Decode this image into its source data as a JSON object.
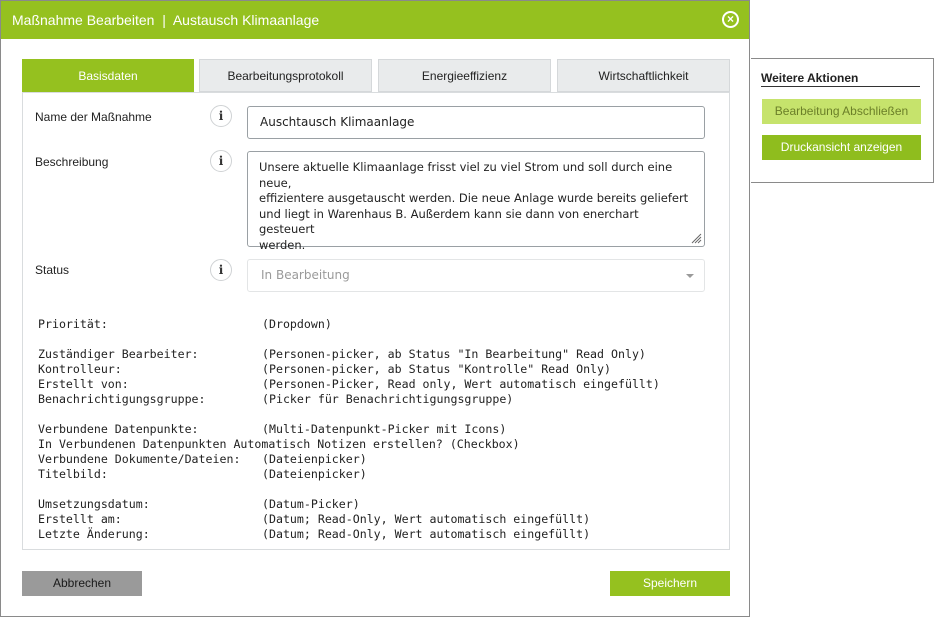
{
  "dialog": {
    "title": "Maßnahme Bearbeiten  |  Austausch Klimaanlage",
    "close_icon": "close-circle-icon"
  },
  "tabs": [
    {
      "label": "Basisdaten",
      "active": true
    },
    {
      "label": "Bearbeitungsprotokoll",
      "active": false
    },
    {
      "label": "Energieeffizienz",
      "active": false
    },
    {
      "label": "Wirtschaftlichkeit",
      "active": false
    }
  ],
  "form": {
    "name_label": "Name der Maßnahme",
    "name_value": "Auschtausch Klimaanlage",
    "description_label": "Beschreibung",
    "description_lines": [
      "Unsere aktuelle Klimaanlage frisst viel zu viel Strom und soll durch eine neue,",
      "effizientere ausgetauscht werden. Die neue Anlage wurde bereits geliefert",
      "und liegt in Warenhaus B. Außerdem kann sie dann von enerchart gesteuert",
      "werden."
    ],
    "status_label": "Status",
    "status_value": "In Bearbeitung",
    "info_icon": "info-icon"
  },
  "spec": [
    {
      "key": "Priorität:",
      "value": "(Dropdown)"
    },
    {
      "key": "Zuständiger Bearbeiter:",
      "value": "(Personen-picker, ab Status \"In Bearbeitung\" Read Only)"
    },
    {
      "key": "Kontrolleur:",
      "value": "(Personen-picker, ab Status \"Kontrolle\" Read Only)"
    },
    {
      "key": "Erstellt von:",
      "value": "(Personen-Picker, Read only, Wert automatisch eingefüllt)"
    },
    {
      "key": "Benachrichtigungsgruppe:",
      "value": "(Picker für Benachrichtigungsgruppe)"
    },
    {
      "key": "Verbundene Datenpunkte:",
      "value": "(Multi-Datenpunkt-Picker mit Icons)"
    },
    {
      "key": "In Verbundenen Datenpunkten Automatisch Notizen erstellen? (Checkbox)",
      "value": ""
    },
    {
      "key": "Verbundene Dokumente/Dateien:",
      "value": "(Dateienpicker)"
    },
    {
      "key": "Titelbild:",
      "value": "(Dateienpicker)"
    },
    {
      "key": "Umsetzungsdatum:",
      "value": "(Datum-Picker)"
    },
    {
      "key": "Erstellt am:",
      "value": "(Datum; Read-Only, Wert automatisch eingefüllt)"
    },
    {
      "key": "Letzte Änderung:",
      "value": "(Datum; Read-Only, Wert automatisch eingefüllt)"
    }
  ],
  "footer": {
    "cancel_label": "Abbrechen",
    "save_label": "Speichern"
  },
  "side": {
    "title": "Weitere Aktionen",
    "finish_label": "Bearbeitung Abschließen",
    "print_label": "Druckansicht anzeigen"
  },
  "colors": {
    "accent": "#95c11f",
    "accent_light": "#c6e36c",
    "cancel_gray": "#9a9a9a"
  }
}
